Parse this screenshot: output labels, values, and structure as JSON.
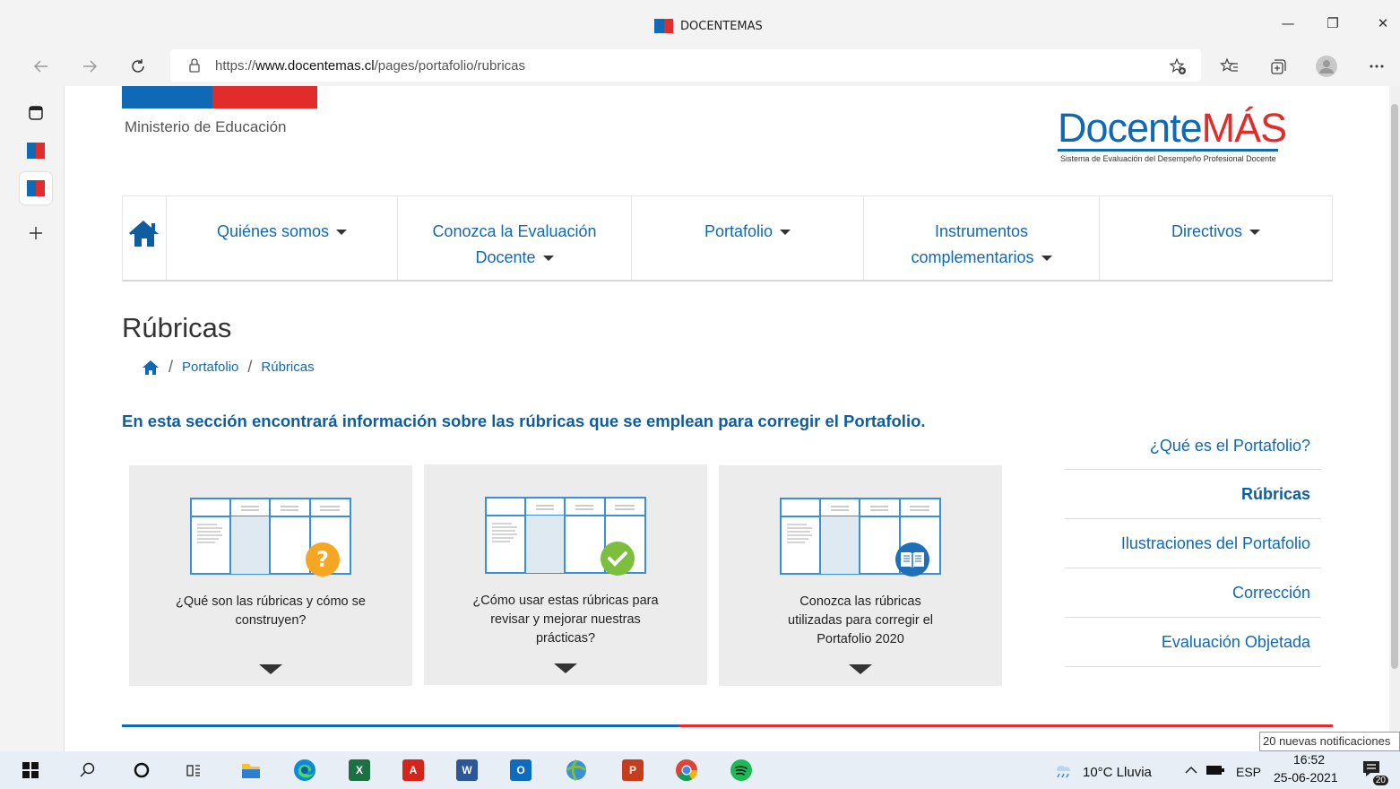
{
  "browser": {
    "tab_title": "DOCENTEMAS",
    "url_base": "https://",
    "url_domain": "www.docentemas.cl",
    "url_path": "/pages/portafolio/rubricas",
    "window_controls": {
      "minimize": "—",
      "restore": "❐",
      "close": "✕"
    }
  },
  "header": {
    "ministry": "Ministerio de Educación",
    "logo_part1": "Docente",
    "logo_part2": "MÁS",
    "logo_subtitle": "Sistema de Evaluación del Desempeño Profesional Docente",
    "colors": {
      "blue": "#0f69b4",
      "red": "#e22c2c"
    }
  },
  "nav": {
    "items": [
      {
        "line1": "Quiénes somos",
        "line2": ""
      },
      {
        "line1": "Conozca la Evaluación",
        "line2": "Docente"
      },
      {
        "line1": "Portafolio",
        "line2": ""
      },
      {
        "line1": "Instrumentos",
        "line2": "complementarios"
      },
      {
        "line1": "Directivos",
        "line2": ""
      }
    ]
  },
  "main": {
    "title": "Rúbricas",
    "breadcrumb": [
      "Portafolio",
      "Rúbricas"
    ],
    "breadcrumb_sep": "/",
    "intro": "En esta sección encontrará información sobre las rúbricas que se emplean para corregir el Portafolio.",
    "cards": [
      {
        "line1": "¿Qué son las rúbricas y cómo se",
        "line2": "construyen?",
        "line3": "",
        "badge": "question-icon",
        "badge_text": "?"
      },
      {
        "line1": "¿Cómo usar estas rúbricas para",
        "line2": "revisar y mejorar nuestras",
        "line3": "prácticas?",
        "badge": "check-icon"
      },
      {
        "line1": "Conozca las rúbricas",
        "line2": "utilizadas para corregir el",
        "line3": "Portafolio 2020",
        "badge": "book-icon"
      }
    ]
  },
  "sidemenu": {
    "items": [
      {
        "label": "¿Qué es el Portafolio?"
      },
      {
        "label": "Rúbricas",
        "active": true
      },
      {
        "label": "Ilustraciones del Portafolio"
      },
      {
        "label": "Corrección"
      },
      {
        "label": "Evaluación Objetada"
      }
    ]
  },
  "notification_toast": "20 nuevas notificaciones",
  "taskbar": {
    "weather": "10°C  Lluvia",
    "lang": "ESP",
    "time": "16:52",
    "date": "25-06-2021",
    "notif_count": "20",
    "app_labels": {
      "excel": "X",
      "acrobat": "A",
      "word": "W",
      "outlook": "O",
      "powerpoint": "P"
    }
  }
}
